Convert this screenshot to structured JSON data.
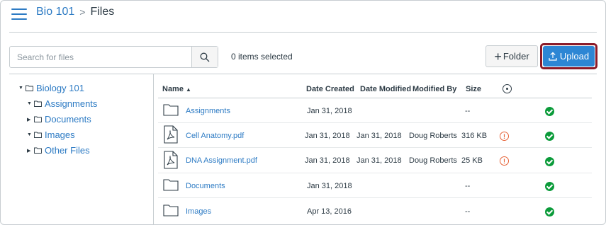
{
  "header": {
    "course": "Bio 101",
    "separator": ">",
    "current": "Files"
  },
  "toolbar": {
    "search_placeholder": "Search for files",
    "selected_count": "0 items selected",
    "folder_label": "Folder",
    "upload_label": "Upload"
  },
  "tree": {
    "root": "Biology 101",
    "children": [
      "Assignments",
      "Documents",
      "Images",
      "Other Files"
    ]
  },
  "table": {
    "columns": {
      "name": "Name",
      "sort": "▲",
      "created": "Date Created",
      "modified": "Date Modified",
      "modified_by": "Modified By",
      "size": "Size"
    },
    "rows": [
      {
        "name": "Assignments",
        "type": "folder",
        "created": "Jan 31, 2018",
        "modified": "",
        "modified_by": "",
        "size": "--",
        "warning": false,
        "published": true
      },
      {
        "name": "Cell Anatomy.pdf",
        "type": "pdf",
        "created": "Jan 31, 2018",
        "modified": "Jan 31, 2018",
        "modified_by": "Doug Roberts",
        "size": "316 KB",
        "warning": true,
        "published": true
      },
      {
        "name": "DNA Assignment.pdf",
        "type": "pdf",
        "created": "Jan 31, 2018",
        "modified": "Jan 31, 2018",
        "modified_by": "Doug Roberts",
        "size": "25 KB",
        "warning": true,
        "published": true
      },
      {
        "name": "Documents",
        "type": "folder",
        "created": "Jan 31, 2018",
        "modified": "",
        "modified_by": "",
        "size": "--",
        "warning": false,
        "published": true
      },
      {
        "name": "Images",
        "type": "folder",
        "created": "Apr 13, 2016",
        "modified": "",
        "modified_by": "",
        "size": "--",
        "warning": false,
        "published": true
      }
    ]
  },
  "icons": {
    "warning_glyph": "!"
  },
  "colors": {
    "link": "#2d7bc4",
    "upload_bg": "#2d86d4",
    "highlight": "#8b1a28",
    "published": "#0b9b3a",
    "warning": "#e66135"
  }
}
